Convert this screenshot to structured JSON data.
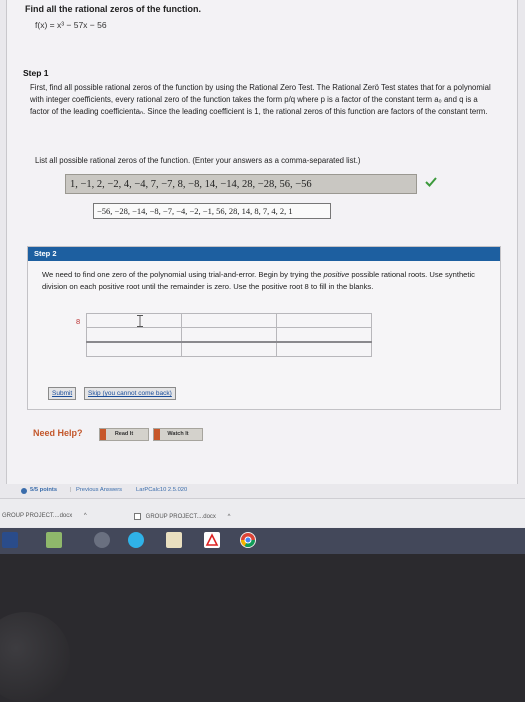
{
  "question": {
    "title": "Find all the rational zeros of the function.",
    "function": "f(x) = x³ − 57x − 56"
  },
  "step1": {
    "label": "Step 1",
    "text": "First, find all possible rational zeros of the function by using the Rational Zero Test. The Rational Zerö Test states that for a polynomial with integer coefficients, every rational zero of the function takes the form p/q where p is a factor of the constant term a₀ and q is a factor of the leading coefficientaₙ. Since the leading coefficient is 1, the rational zeros of this function are factors of the constant term.",
    "list_prompt": "List all possible rational zeros of the function. (Enter your answers as a comma-separated list.)",
    "answer_value": "1, −1, 2, −2, 4, −4, 7, −7, 8, −8, 14, −14, 28, −28, 56, −56",
    "correct_answer": "−56, −28, −14, −8, −7, −4, −2, −1, 56, 28, 14, 8, 7, 4, 2, 1"
  },
  "step2": {
    "label": "Step 2",
    "text_a": "We need to find one zero of the polynomial using trial-and-error. Begin by trying the",
    "text_em": "positive",
    "text_b": "possible rational roots. Use synthetic division on each positive root until the remainder is zero. Use the positive root 8 to fill in the blanks.",
    "root": "8",
    "submit_label": "Submit",
    "skip_label": "Skip (you cannot come back)"
  },
  "help": {
    "label": "Need Help?",
    "read_label": "Read It",
    "watch_label": "Watch It"
  },
  "footer": {
    "points": "5/5 points",
    "previous": "Previous Answers",
    "code": "LarPCalc10 2.5.020"
  },
  "downloads": [
    {
      "name": "GROUP PROJECT....docx"
    },
    {
      "name": "GROUP PROJECT....docx"
    }
  ],
  "colors": {
    "step_header": "#1d5fa0",
    "need_help": "#c3572b",
    "check": "#3c9a3c",
    "taskbar": "#43485a"
  }
}
